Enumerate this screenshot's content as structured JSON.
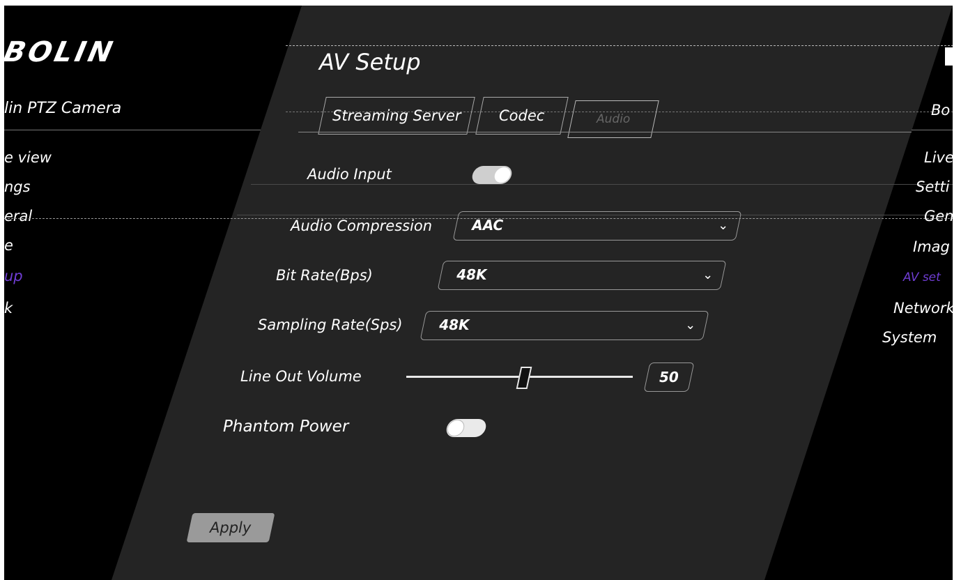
{
  "brand": {
    "logo": "BOLIN",
    "device_name": "lin PTZ Camera"
  },
  "left_nav": [
    {
      "label": "e view",
      "active": false
    },
    {
      "label": "ngs",
      "active": false
    },
    {
      "label": "eral",
      "active": false
    },
    {
      "label": "e",
      "active": false
    },
    {
      "label": "up",
      "active": true
    },
    {
      "label": "k",
      "active": false
    }
  ],
  "right_nav": {
    "header": "Bo",
    "items": [
      {
        "label": "Live",
        "active": false
      },
      {
        "label": "Setti",
        "active": false
      },
      {
        "label": "Gen",
        "active": false
      },
      {
        "label": "Imag",
        "active": false
      },
      {
        "label": "AV set",
        "active": true
      },
      {
        "label": "Network",
        "active": false
      },
      {
        "label": "System",
        "active": false
      }
    ]
  },
  "page": {
    "title": "AV Setup",
    "tabs": [
      {
        "label": "Streaming Server",
        "active": false
      },
      {
        "label": "Codec",
        "active": false
      },
      {
        "label": "Audio",
        "active": true
      }
    ]
  },
  "form": {
    "audio_input": {
      "label": "Audio Input",
      "on": true
    },
    "audio_compression": {
      "label": "Audio Compression",
      "value": "AAC"
    },
    "bit_rate": {
      "label": "Bit Rate(Bps)",
      "value": "48K"
    },
    "sampling_rate": {
      "label": "Sampling Rate(Sps)",
      "value": "48K"
    },
    "line_out_volume": {
      "label": "Line Out Volume",
      "value": "50",
      "level": 50
    },
    "phantom_power": {
      "label": "Phantom Power",
      "on": false
    }
  },
  "apply_label": "Apply",
  "colors": {
    "panel": "#242424",
    "accent": "#6f3dd3",
    "background": "#000000"
  }
}
